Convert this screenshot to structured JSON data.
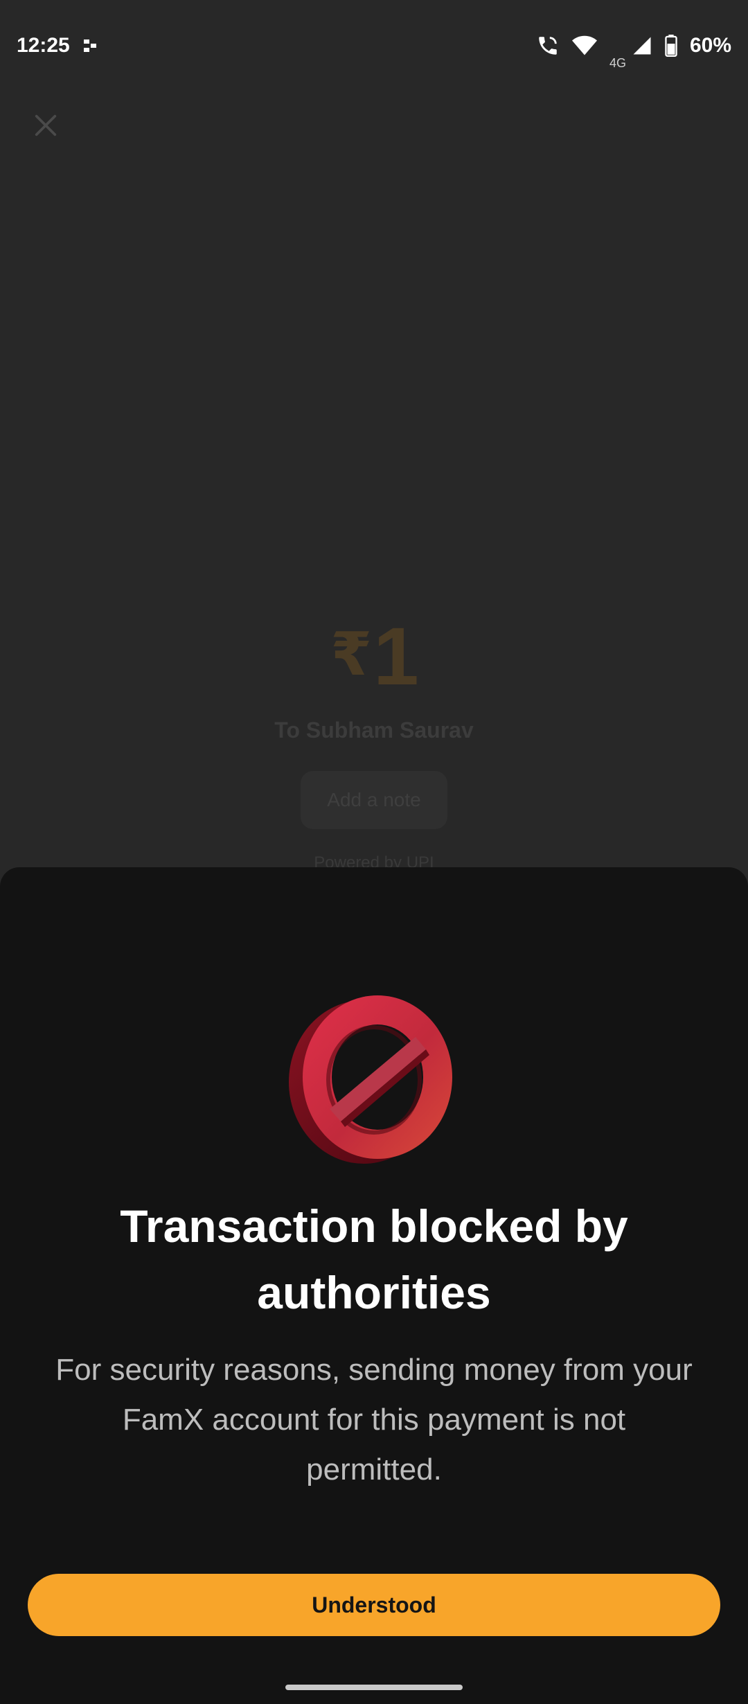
{
  "status_bar": {
    "time": "12:25",
    "network_label": "4G",
    "battery_percent": "60%",
    "icons": [
      "notification-icon",
      "wifi-calling-icon",
      "wifi-icon",
      "signal-icon",
      "battery-icon"
    ]
  },
  "payment": {
    "currency_symbol": "₹",
    "amount": "1",
    "recipient": "To Subham Saurav",
    "note_placeholder": "Add a note",
    "powered_by": "Powered by UPI"
  },
  "sheet": {
    "icon": "blocked-icon",
    "title": "Transaction blocked by authorities",
    "description": "For security reasons, sending money from your FamX account for this payment is not permitted.",
    "button_label": "Understood"
  },
  "colors": {
    "accent": "#f8a52a",
    "sheet_background": "#131313",
    "page_background": "#282828",
    "block_red": "#c8283a"
  }
}
